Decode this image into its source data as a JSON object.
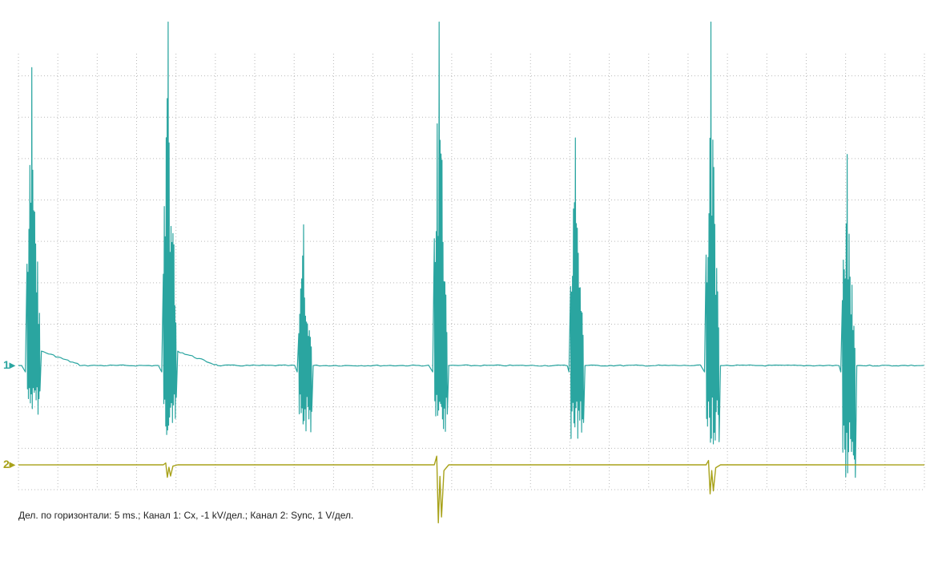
{
  "caption": "Дел. по горизонтали: 5 ms.; Канал 1: Cx, -1 kV/дел.; Канал 2: Sync, 1 V/дел.",
  "colors": {
    "background": "#ffffff",
    "grid": "#b9b9b9",
    "channel1": "#2aa5a0",
    "channel2": "#a8a21a",
    "caption": "#222222"
  },
  "chart_data": {
    "type": "line",
    "grid": true,
    "x_divisions": 23,
    "y_divisions": 11,
    "x_unit": "ms",
    "ms_per_div": 5,
    "series": [
      {
        "marker": "1",
        "scale_per_div": "-1 kV",
        "baseline_div": 8,
        "bursts": [
          {
            "x_ms": 1.7,
            "up": 7.2,
            "down": 1.2,
            "decay": "tail"
          },
          {
            "x_ms": 19.0,
            "up": 8.3,
            "down": 1.7,
            "decay": "tail"
          },
          {
            "x_ms": 36.2,
            "up": 3.4,
            "down": 1.7,
            "decay": "short"
          },
          {
            "x_ms": 53.4,
            "up": 8.3,
            "down": 1.7,
            "decay": "short"
          },
          {
            "x_ms": 70.7,
            "up": 5.5,
            "down": 1.8,
            "decay": "short"
          },
          {
            "x_ms": 87.9,
            "up": 8.3,
            "down": 1.9,
            "decay": "short"
          },
          {
            "x_ms": 105.2,
            "up": 5.1,
            "down": 3.1,
            "decay": "short"
          }
        ]
      },
      {
        "marker": "2",
        "scale_per_div": "1 V",
        "baseline_div": 10.4,
        "pulses": [
          {
            "x_ms": 19.0,
            "depth": 0.3
          },
          {
            "x_ms": 53.4,
            "depth": 1.4
          },
          {
            "x_ms": 87.9,
            "depth": 0.7
          }
        ]
      }
    ]
  }
}
